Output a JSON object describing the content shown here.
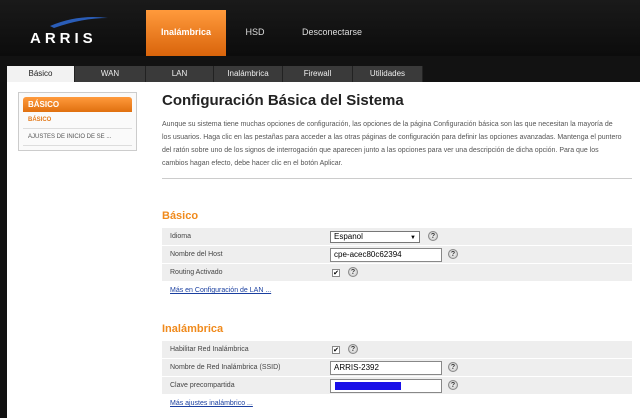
{
  "brand": {
    "logo_text": "ARRIS"
  },
  "top_nav": [
    {
      "label": "Inalámbrica",
      "active": true
    },
    {
      "label": "HSD",
      "active": false
    },
    {
      "label": "Desconectarse",
      "active": false
    }
  ],
  "tabs": [
    {
      "label": "Básico",
      "active": true
    },
    {
      "label": "WAN",
      "active": false
    },
    {
      "label": "LAN",
      "active": false
    },
    {
      "label": "Inalámbrica",
      "active": false
    },
    {
      "label": "Firewall",
      "active": false
    },
    {
      "label": "Utilidades",
      "active": false
    }
  ],
  "sidebar": {
    "header": "BÁSICO",
    "items": [
      {
        "label": "BÁSICO",
        "selected": true
      },
      {
        "label": "AJUSTES DE INICIO DE SE ...",
        "selected": false
      }
    ]
  },
  "main": {
    "title": "Configuración Básica del Sistema",
    "intro": "Aunque su sistema tiene muchas opciones de configuración, las opciones de la página Configuración básica son las que necesitan la mayoría de los usuarios. Haga clic en las pestañas para acceder a las otras páginas de configuración para definir las opciones avanzadas. Mantenga el puntero del ratón sobre uno de los signos de interrogación que aparecen junto a las opciones para ver una descripción de dicha opción. Para que los cambios hagan efecto, debe hacer clic en el botón Aplicar."
  },
  "basic": {
    "title": "Básico",
    "language_label": "Idioma",
    "language_value": "Espanol",
    "hostname_label": "Nombre del Host",
    "hostname_value": "cpe-acec80c62394",
    "routing_label": "Routing Activado",
    "routing_checked": "✔",
    "lan_link": "Más en Configuración de LAN ..."
  },
  "wireless": {
    "title": "Inalámbrica",
    "enable_label": "Habilitar Red Inalámbrica",
    "enable_checked": "✔",
    "ssid_label": "Nombre de Red Inalámbrica (SSID)",
    "ssid_value": "ARRIS-2392",
    "psk_label": "Clave precompartida",
    "more_link": "Más ajustes inalámbrico ..."
  },
  "help_glyph": "?",
  "select_arrow": "▼",
  "colors": {
    "accent": "#f08a1c",
    "link": "#1a3fa0",
    "redaction": "#1a10e8"
  }
}
